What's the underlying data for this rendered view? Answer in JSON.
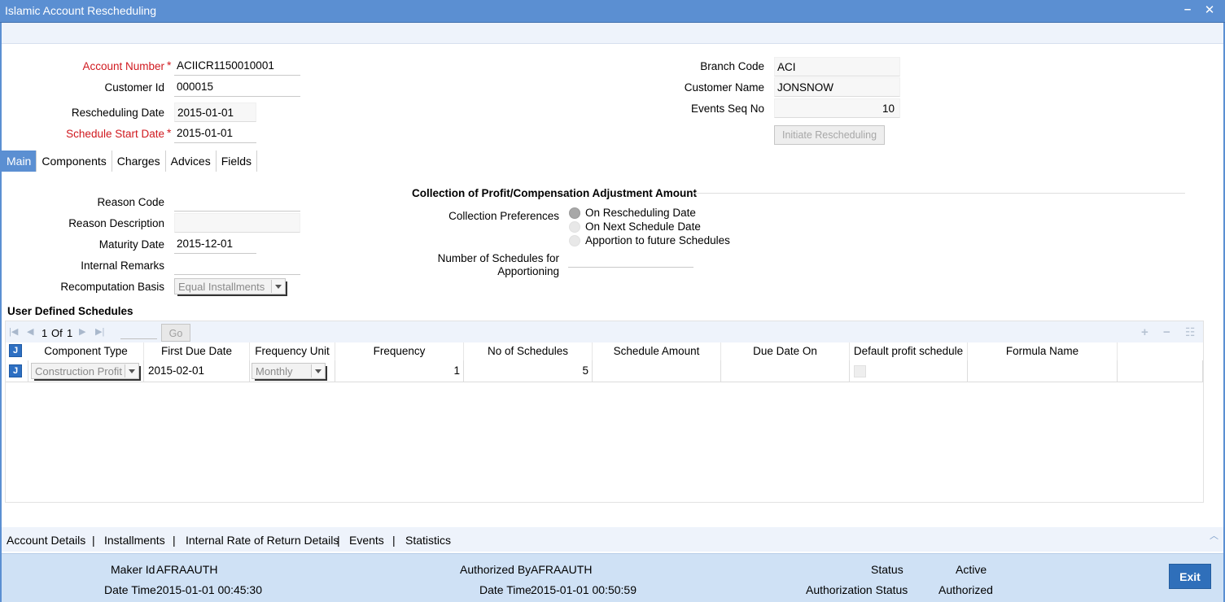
{
  "window": {
    "title": "Islamic Account Rescheduling",
    "minimize": "–",
    "close": "✕"
  },
  "header": {
    "account_number": {
      "label": "Account Number",
      "value": "ACIICR1150010001"
    },
    "customer_id": {
      "label": "Customer Id",
      "value": "000015"
    },
    "rescheduling_date": {
      "label": "Rescheduling Date",
      "value": "2015-01-01"
    },
    "schedule_start_date": {
      "label": "Schedule Start Date",
      "value": "2015-01-01"
    },
    "branch_code": {
      "label": "Branch Code",
      "value": "ACI"
    },
    "customer_name": {
      "label": "Customer Name",
      "value": "JONSNOW"
    },
    "events_seq_no": {
      "label": "Events Seq No",
      "value": "10"
    },
    "initiate_button": "Initiate Rescheduling",
    "required_mark": "*"
  },
  "tabs": [
    "Main",
    "Components",
    "Charges",
    "Advices",
    "Fields"
  ],
  "main": {
    "reason_code": {
      "label": "Reason Code",
      "value": ""
    },
    "reason_description": {
      "label": "Reason Description",
      "value": ""
    },
    "maturity_date": {
      "label": "Maturity Date",
      "value": "2015-12-01"
    },
    "internal_remarks": {
      "label": "Internal Remarks",
      "value": ""
    },
    "recomputation_basis": {
      "label": "Recomputation Basis",
      "value": "Equal Installments"
    },
    "collection": {
      "title": "Collection of Profit/Compensation Adjustment Amount",
      "preferences_label": "Collection Preferences",
      "options": [
        "On Rescheduling Date",
        "On Next Schedule Date",
        "Apportion to future Schedules"
      ],
      "selected": "On Rescheduling Date",
      "schedules_label_line1": "Number of Schedules for",
      "schedules_label_line2": "Apportioning",
      "schedules_value": ""
    }
  },
  "schedules": {
    "title": "User Defined Schedules",
    "pager": {
      "current": "1",
      "of_label": "Of",
      "total": "1",
      "go": "Go"
    },
    "toolbar": {
      "add": "+",
      "remove": "−",
      "view": "☷"
    },
    "columns": [
      "Component Type",
      "First Due Date",
      "Frequency Unit",
      "Frequency",
      "No of Schedules",
      "Schedule Amount",
      "Due Date On",
      "Default profit schedule",
      "Formula Name"
    ],
    "rows": [
      {
        "component_type": "Construction Profit",
        "first_due_date": "2015-02-01",
        "frequency_unit": "Monthly",
        "frequency": "1",
        "no_of_schedules": "5",
        "schedule_amount": "",
        "due_date_on": "",
        "formula_name": ""
      }
    ]
  },
  "bottom_links": [
    "Account Details",
    "Installments",
    "Internal Rate of Return Details",
    "Events",
    "Statistics"
  ],
  "link_separator": "|",
  "footer": {
    "maker_id_label": "Maker Id",
    "maker_id": "AFRAAUTH",
    "maker_datetime_label": "Date Time",
    "maker_datetime": "2015-01-01 00:45:30",
    "authorized_by_label": "Authorized By",
    "authorized_by": "AFRAAUTH",
    "auth_datetime_label": "Date Time",
    "auth_datetime": "2015-01-01 00:50:59",
    "status_label": "Status",
    "status": "Active",
    "auth_status_label": "Authorization Status",
    "auth_status": "Authorized",
    "exit": "Exit"
  },
  "colors": {
    "title_bar": "#5b8fd2",
    "required": "#d0191f",
    "footer_bg": "#cfe1f5",
    "exit_button": "#2f6fba"
  },
  "icons": {
    "minimize": "minimize-icon",
    "close": "close-icon",
    "first_page": "first-page-icon",
    "prev_page": "prev-page-icon",
    "next_page": "next-page-icon",
    "last_page": "last-page-icon",
    "select_all": "select-all-checkbox-icon",
    "row_select": "row-checkbox-icon",
    "scroll_up": "scroll-up-icon"
  }
}
